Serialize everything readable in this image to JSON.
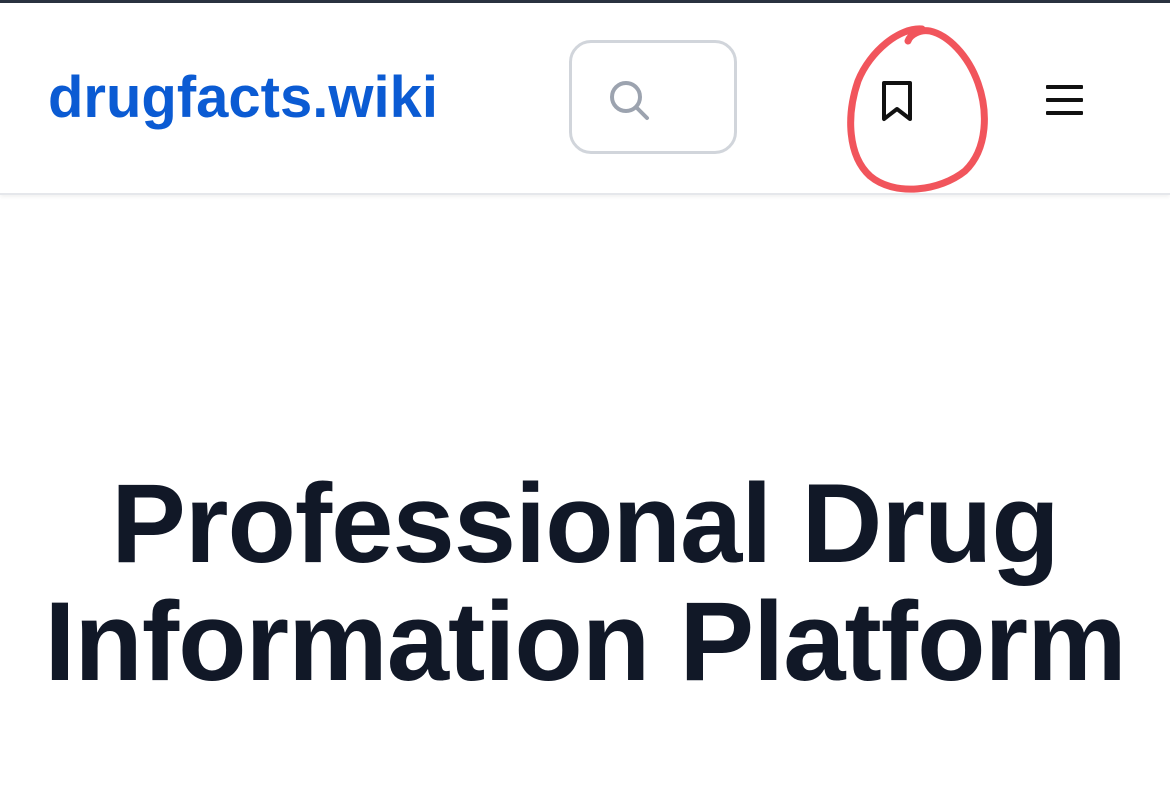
{
  "header": {
    "logo_text": "drugfacts.wiki",
    "search_icon": "search-icon",
    "bookmark_icon": "bookmark-icon",
    "menu_icon": "hamburger-menu-icon",
    "annotation_color": "#f0424a"
  },
  "hero": {
    "title": "Professional Drug Information Platform"
  },
  "colors": {
    "brand": "#0b5bd3",
    "title": "#111827",
    "border": "#d1d5db"
  }
}
